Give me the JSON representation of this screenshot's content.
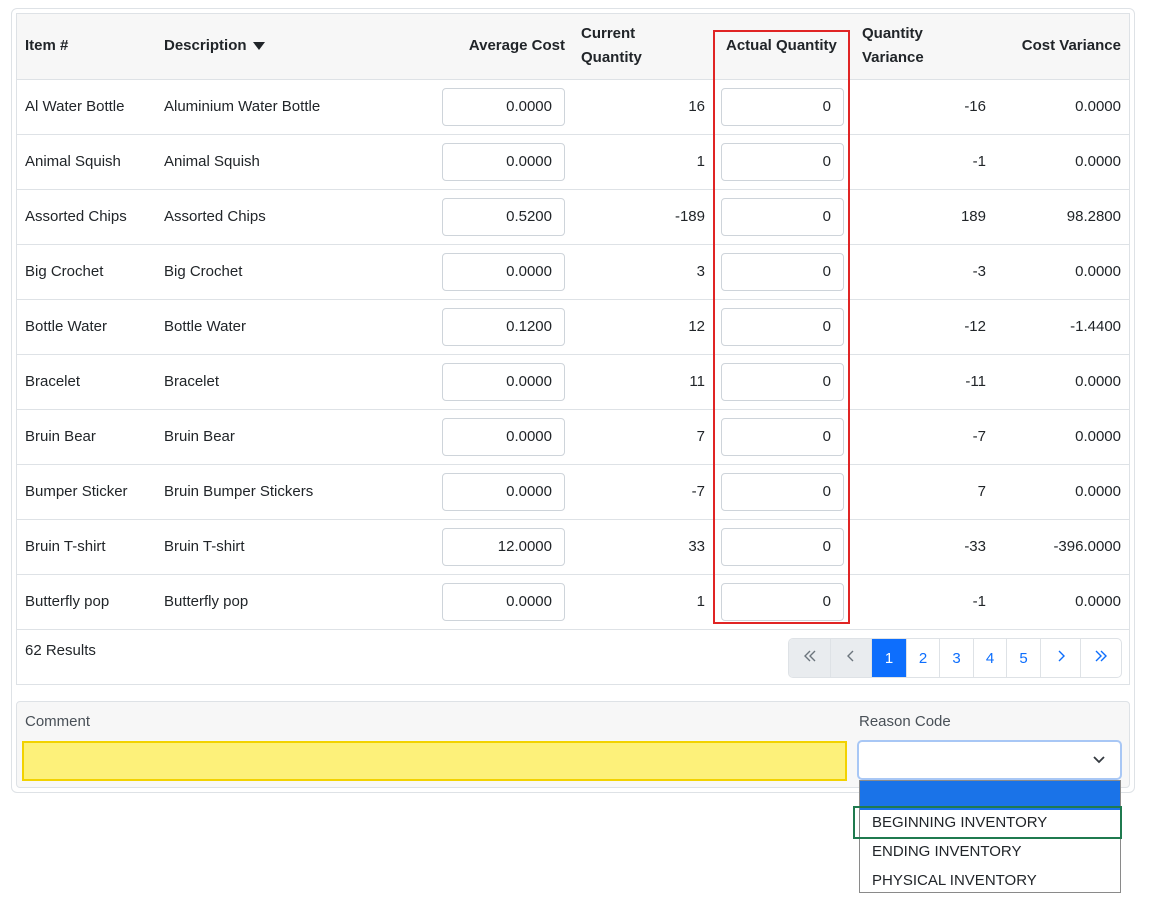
{
  "table": {
    "headers": {
      "item": "Item #",
      "description": "Description",
      "average_cost": "Average Cost",
      "current_quantity_1": "Current",
      "current_quantity_2": "Quantity",
      "actual_quantity": "Actual Quantity",
      "quantity_variance_1": "Quantity",
      "quantity_variance_2": "Variance",
      "cost_variance": "Cost Variance"
    },
    "sort_indicator": "chevron-down-icon",
    "rows": [
      {
        "item": "Al Water Bottle",
        "description": "Aluminium Water Bottle",
        "average_cost": "0.0000",
        "current_quantity": "16",
        "actual_quantity": "0",
        "quantity_variance": "-16",
        "cost_variance": "0.0000"
      },
      {
        "item": "Animal Squish",
        "description": "Animal Squish",
        "average_cost": "0.0000",
        "current_quantity": "1",
        "actual_quantity": "0",
        "quantity_variance": "-1",
        "cost_variance": "0.0000"
      },
      {
        "item": "Assorted Chips",
        "description": "Assorted Chips",
        "average_cost": "0.5200",
        "current_quantity": "-189",
        "actual_quantity": "0",
        "quantity_variance": "189",
        "cost_variance": "98.2800"
      },
      {
        "item": "Big Crochet",
        "description": "Big Crochet",
        "average_cost": "0.0000",
        "current_quantity": "3",
        "actual_quantity": "0",
        "quantity_variance": "-3",
        "cost_variance": "0.0000"
      },
      {
        "item": "Bottle Water",
        "description": "Bottle Water",
        "average_cost": "0.1200",
        "current_quantity": "12",
        "actual_quantity": "0",
        "quantity_variance": "-12",
        "cost_variance": "-1.4400"
      },
      {
        "item": "Bracelet",
        "description": "Bracelet",
        "average_cost": "0.0000",
        "current_quantity": "11",
        "actual_quantity": "0",
        "quantity_variance": "-11",
        "cost_variance": "0.0000"
      },
      {
        "item": "Bruin Bear",
        "description": "Bruin Bear",
        "average_cost": "0.0000",
        "current_quantity": "7",
        "actual_quantity": "0",
        "quantity_variance": "-7",
        "cost_variance": "0.0000"
      },
      {
        "item": "Bumper Sticker",
        "description": "Bruin Bumper Stickers",
        "average_cost": "0.0000",
        "current_quantity": "-7",
        "actual_quantity": "0",
        "quantity_variance": "7",
        "cost_variance": "0.0000"
      },
      {
        "item": "Bruin T-shirt",
        "description": "Bruin T-shirt",
        "average_cost": "12.0000",
        "current_quantity": "33",
        "actual_quantity": "0",
        "quantity_variance": "-33",
        "cost_variance": "-396.0000"
      },
      {
        "item": "Butterfly pop",
        "description": "Butterfly pop",
        "average_cost": "0.0000",
        "current_quantity": "1",
        "actual_quantity": "0",
        "quantity_variance": "-1",
        "cost_variance": "0.0000"
      }
    ]
  },
  "pagination": {
    "results_text": "62 Results",
    "pages": [
      "1",
      "2",
      "3",
      "4",
      "5"
    ],
    "current_page": "1",
    "first_icon": "double-chevron-left-icon",
    "prev_icon": "chevron-left-icon",
    "next_icon": "chevron-right-icon",
    "last_icon": "double-chevron-right-icon"
  },
  "form": {
    "comment_label": "Comment",
    "comment_value": "",
    "reason_code_label": "Reason Code",
    "reason_code_value": "",
    "reason_code_options": [
      "",
      "BEGINNING INVENTORY",
      "ENDING INVENTORY",
      "PHYSICAL INVENTORY"
    ]
  },
  "colors": {
    "accent": "#0d6efd",
    "highlight_red": "#e02424",
    "highlight_yellow": "#fdf17a",
    "highlight_green": "#1f7a4f",
    "dropdown_selected": "#1a73e8"
  }
}
